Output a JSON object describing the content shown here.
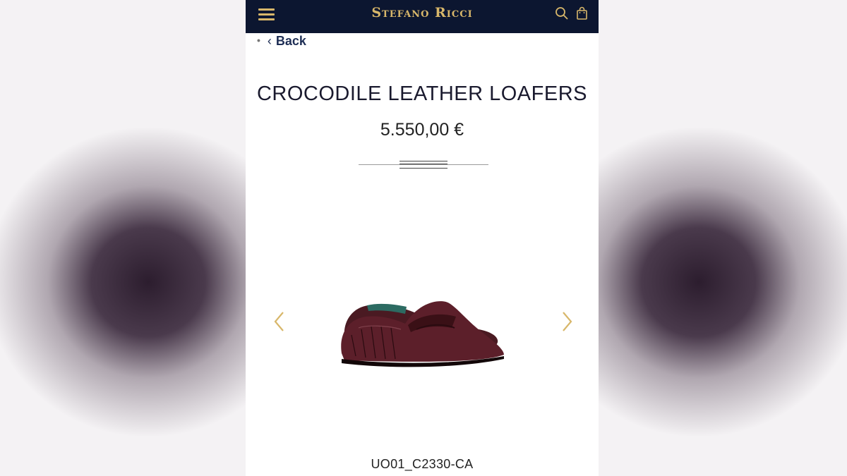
{
  "header": {
    "brand": "Stefano Ricci",
    "menu_icon": "hamburger-icon",
    "search_icon": "search-icon",
    "bag_icon": "shopping-bag-icon"
  },
  "nav": {
    "back_label": "Back"
  },
  "product": {
    "title": "CROCODILE LEATHER LOAFERS",
    "price": "5.550,00 €",
    "sku": "UO01_C2330-CA",
    "image_alt": "crocodile leather penny loafers"
  },
  "colors": {
    "header_bg": "#0c1630",
    "accent_gold": "#d8b76a",
    "back_link": "#1e2e55"
  }
}
